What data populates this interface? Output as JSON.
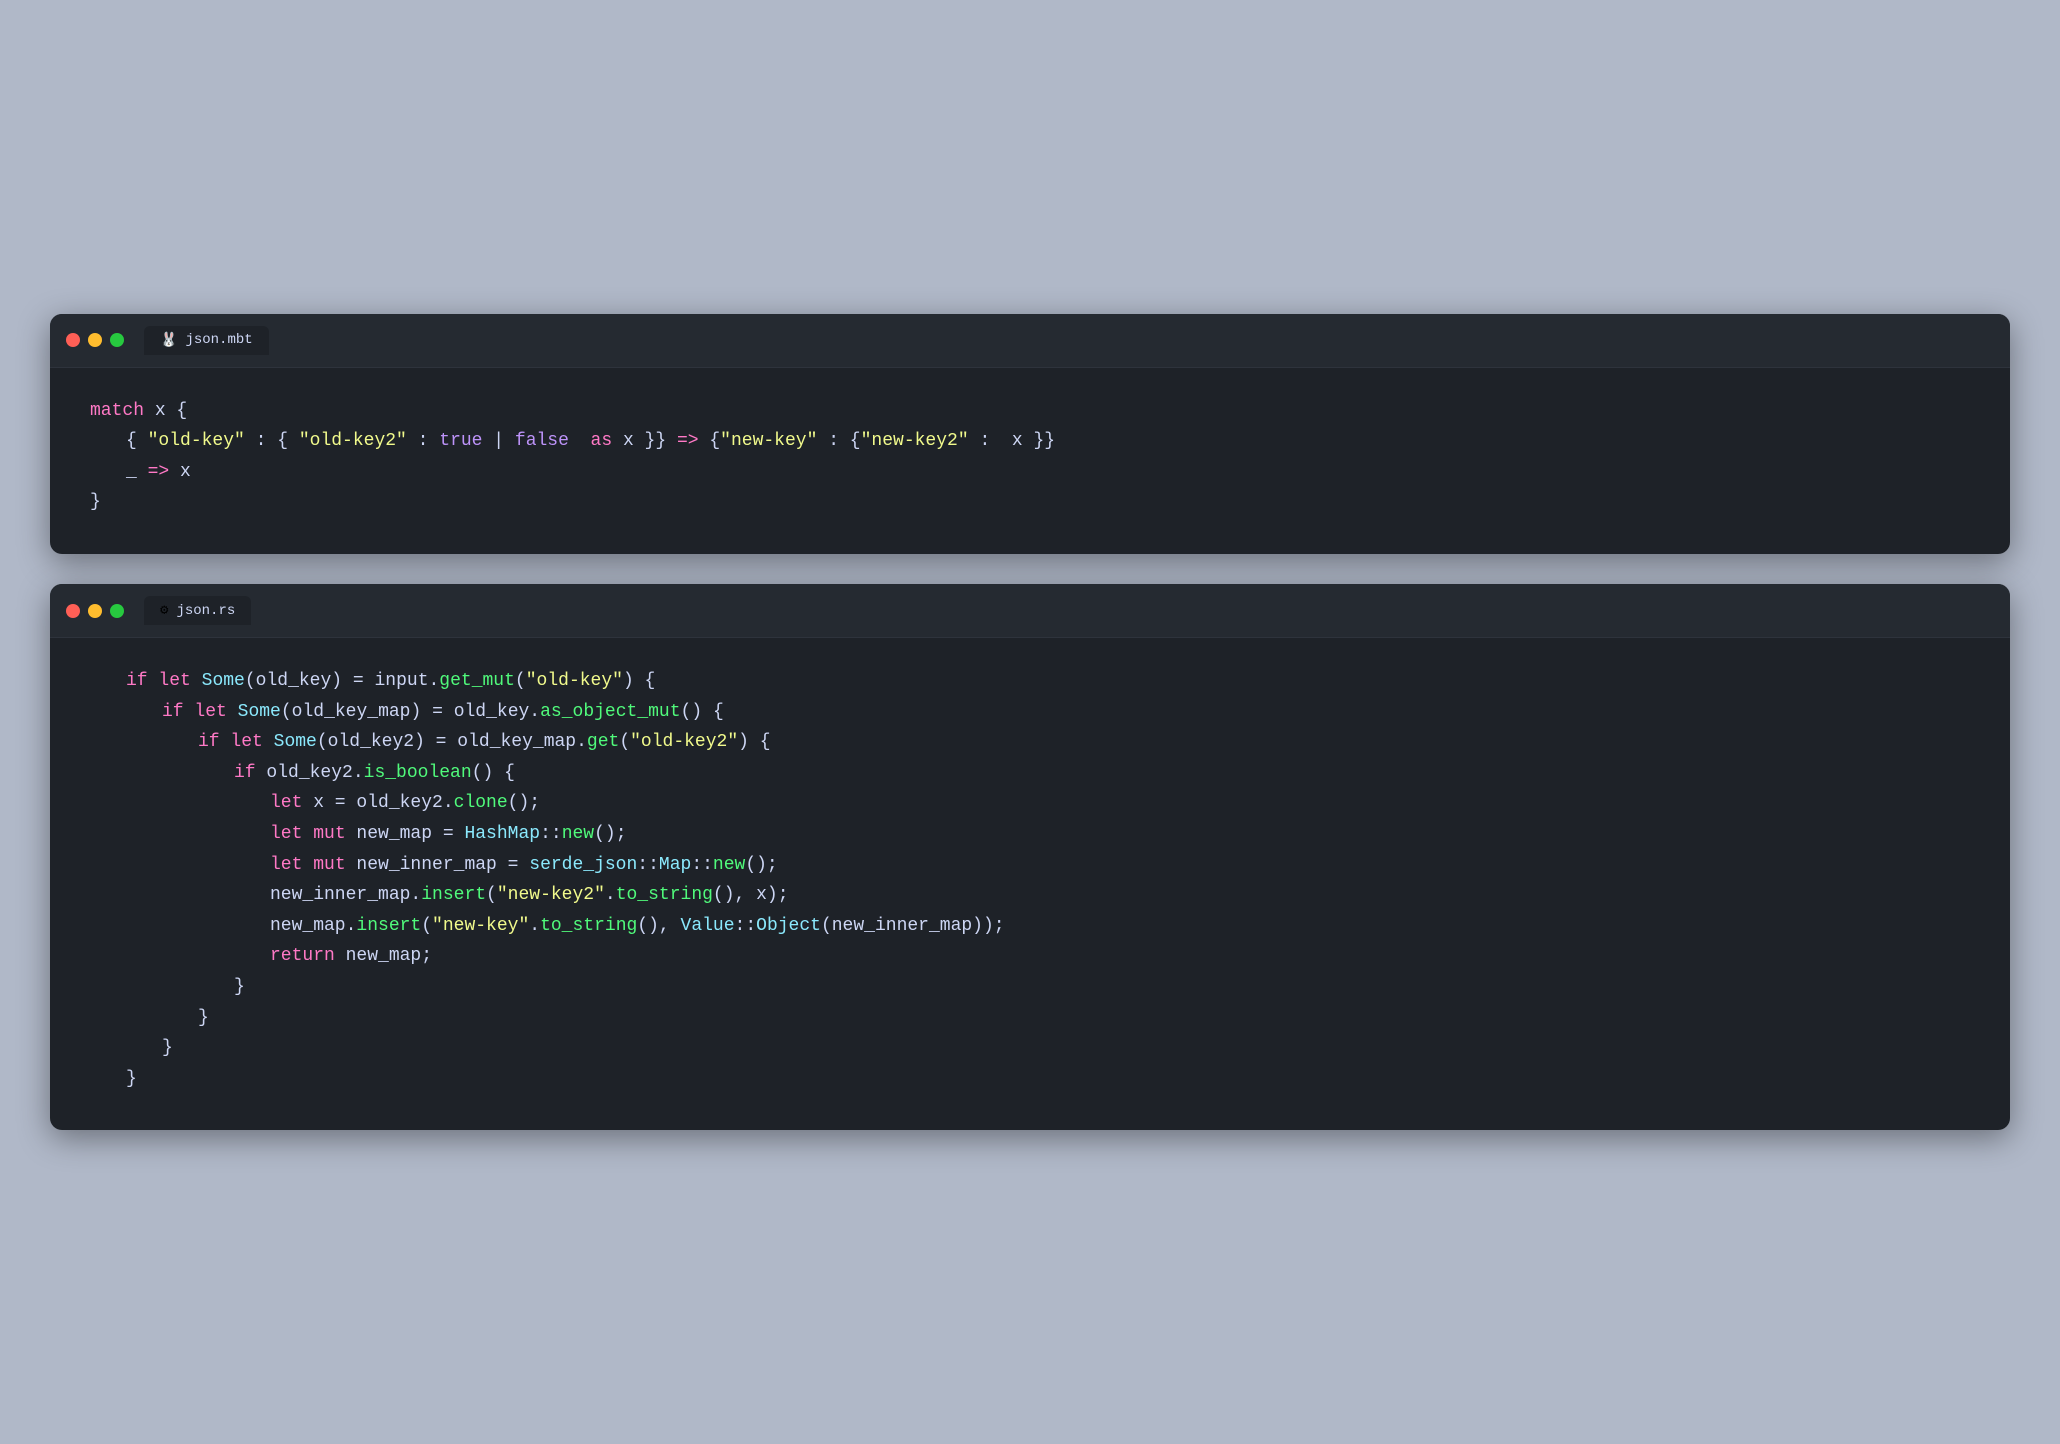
{
  "window1": {
    "title": "json.mbt",
    "icon": "🐰",
    "tab_label": "json.mbt"
  },
  "window2": {
    "title": "json.rs",
    "icon": "⚙",
    "tab_label": "json.rs"
  }
}
